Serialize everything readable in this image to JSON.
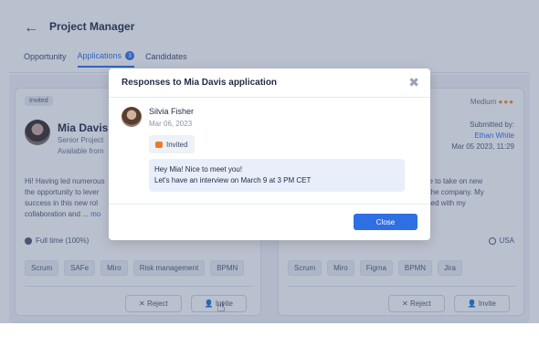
{
  "header": {
    "back_icon": "arrow-left-icon",
    "title": "Project Manager",
    "tabs": [
      {
        "label": "Opportunity"
      },
      {
        "label": "Applications",
        "badge": "3",
        "active": true
      },
      {
        "label": "Candidates"
      }
    ]
  },
  "cards": {
    "left": {
      "status": "Invited",
      "name": "Mia Davis",
      "role": "Senior Project",
      "availability": "Available from",
      "description_lines": [
        "Hi! Having led numerous",
        "the opportunity to lever",
        "success in this new rol",
        "collaboration and ..."
      ],
      "more": "mo",
      "employment": "Full time (100%)",
      "tags": [
        "Scrum",
        "SAFe",
        "Miro",
        "Risk management",
        "BPMN"
      ],
      "reject_label": "Reject",
      "invite_label": "Invite"
    },
    "right": {
      "priority": "Medium",
      "submitted_label": "Submitted by:",
      "submitted_by": "Ethan White",
      "submitted_date": "Mar 05 2023, 11:29",
      "description_lines": [
        "nce to take on new",
        "in the company. My",
        "bined with my"
      ],
      "country": "USA",
      "tags": [
        "Scrum",
        "Miro",
        "Figma",
        "BPMN",
        "Jira"
      ],
      "reject_label": "Reject",
      "invite_label": "Invite"
    }
  },
  "modal": {
    "title": "Responses to Mia Davis application",
    "close_icon": "close-icon",
    "responder": {
      "name": "Silvia Fisher",
      "date": "Mar 06, 2023",
      "status": "Invited",
      "message_line1": "Hey Mia! Nice to meet you!",
      "message_line2": "Let's have an interview on March 9 at 3 PM CET"
    },
    "close_button": "Close"
  },
  "colors": {
    "accent": "#2f6fe4",
    "status_icon": "#ee7a2a",
    "priority": "#ee8a2a"
  }
}
